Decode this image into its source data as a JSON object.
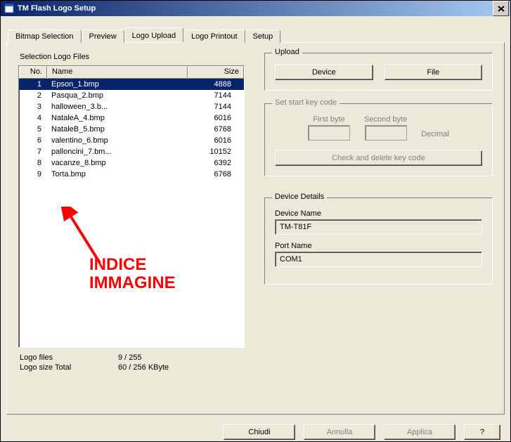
{
  "window": {
    "title": "TM Flash Logo Setup",
    "close_icon_label": "×"
  },
  "tabs": [
    {
      "label": "Bitmap Selection",
      "active": false
    },
    {
      "label": "Preview",
      "active": false
    },
    {
      "label": "Logo Upload",
      "active": true
    },
    {
      "label": "Logo Printout",
      "active": false
    },
    {
      "label": "Setup",
      "active": false
    }
  ],
  "selection": {
    "label": "Selection Logo Files",
    "columns": {
      "no": "No.",
      "name": "Name",
      "size": "Size"
    },
    "rows": [
      {
        "no": "1",
        "name": "Epson_1.bmp",
        "size": "4888",
        "selected": true
      },
      {
        "no": "2",
        "name": "Pasqua_2.bmp",
        "size": "7144",
        "selected": false
      },
      {
        "no": "3",
        "name": "halloween_3.b...",
        "size": "7144",
        "selected": false
      },
      {
        "no": "4",
        "name": "NataleA_4.bmp",
        "size": "6016",
        "selected": false
      },
      {
        "no": "5",
        "name": "NataleB_5.bmp",
        "size": "6768",
        "selected": false
      },
      {
        "no": "6",
        "name": "valentino_6.bmp",
        "size": "6016",
        "selected": false
      },
      {
        "no": "7",
        "name": "palloncini_7.bm...",
        "size": "10152",
        "selected": false
      },
      {
        "no": "8",
        "name": "vacanze_8.bmp",
        "size": "6392",
        "selected": false
      },
      {
        "no": "9",
        "name": "Torta.bmp",
        "size": "6768",
        "selected": false
      }
    ],
    "stats": {
      "files_label": "Logo files",
      "files_value": "9 / 255",
      "total_label": "Logo size Total",
      "total_value": "60 / 256 KByte"
    }
  },
  "annotation": {
    "line1": "INDICE",
    "line2": "IMMAGINE"
  },
  "upload": {
    "title": "Upload",
    "device_btn": "Device",
    "file_btn": "File"
  },
  "keycode": {
    "title": "Set start key code",
    "first_byte_label": "First byte",
    "second_byte_label": "Second byte",
    "decimal_label": "Decimal",
    "check_btn": "Check and delete key code"
  },
  "device_details": {
    "title": "Device Details",
    "device_name_label": "Device Name",
    "device_name_value": "TM-T81F",
    "port_name_label": "Port Name",
    "port_name_value": "COM1"
  },
  "footer": {
    "close": "Chiudi",
    "cancel": "Annulla",
    "apply": "Applica",
    "help": "?"
  },
  "colors": {
    "selected_bg": "#0a246a",
    "annotation": "#ff0000",
    "dialog_bg": "#ece9d8"
  }
}
